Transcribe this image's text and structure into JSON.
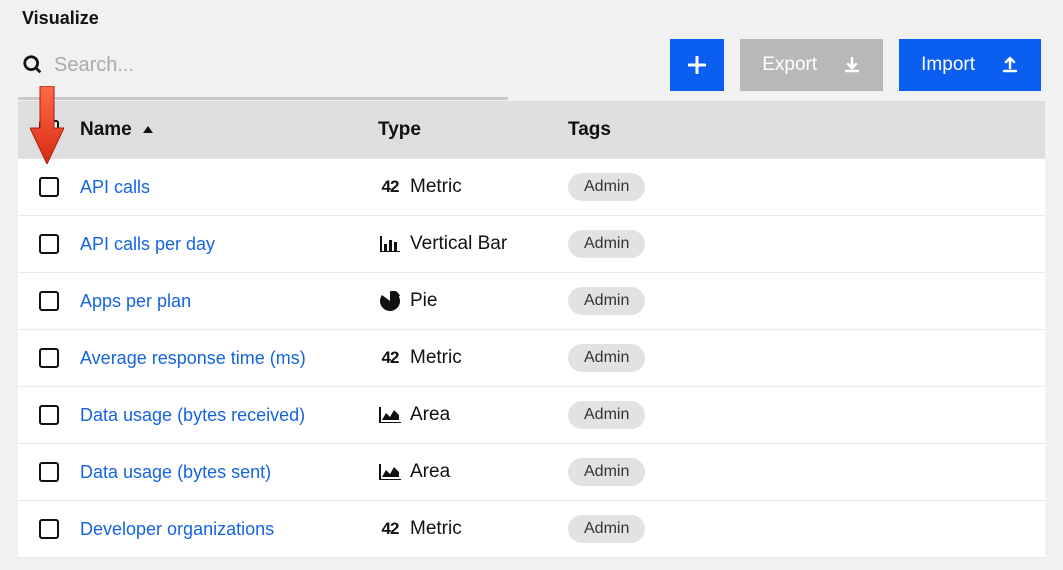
{
  "page": {
    "title": "Visualize"
  },
  "search": {
    "placeholder": "Search..."
  },
  "actions": {
    "add_label": "",
    "export_label": "Export",
    "import_label": "Import"
  },
  "columns": {
    "name": "Name",
    "type": "Type",
    "tags": "Tags"
  },
  "sort": {
    "column": "name",
    "direction": "asc"
  },
  "type_icons": {
    "metric": "42",
    "vertical_bar": "bar",
    "pie": "pie",
    "area": "area"
  },
  "rows": [
    {
      "name": "API calls",
      "type_key": "metric",
      "type_label": "Metric",
      "tags": [
        "Admin"
      ]
    },
    {
      "name": "API calls per day",
      "type_key": "vertical_bar",
      "type_label": "Vertical Bar",
      "tags": [
        "Admin"
      ]
    },
    {
      "name": "Apps per plan",
      "type_key": "pie",
      "type_label": "Pie",
      "tags": [
        "Admin"
      ]
    },
    {
      "name": "Average response time (ms)",
      "type_key": "metric",
      "type_label": "Metric",
      "tags": [
        "Admin"
      ]
    },
    {
      "name": "Data usage (bytes received)",
      "type_key": "area",
      "type_label": "Area",
      "tags": [
        "Admin"
      ]
    },
    {
      "name": "Data usage (bytes sent)",
      "type_key": "area",
      "type_label": "Area",
      "tags": [
        "Admin"
      ]
    },
    {
      "name": "Developer organizations",
      "type_key": "metric",
      "type_label": "Metric",
      "tags": [
        "Admin"
      ]
    }
  ]
}
